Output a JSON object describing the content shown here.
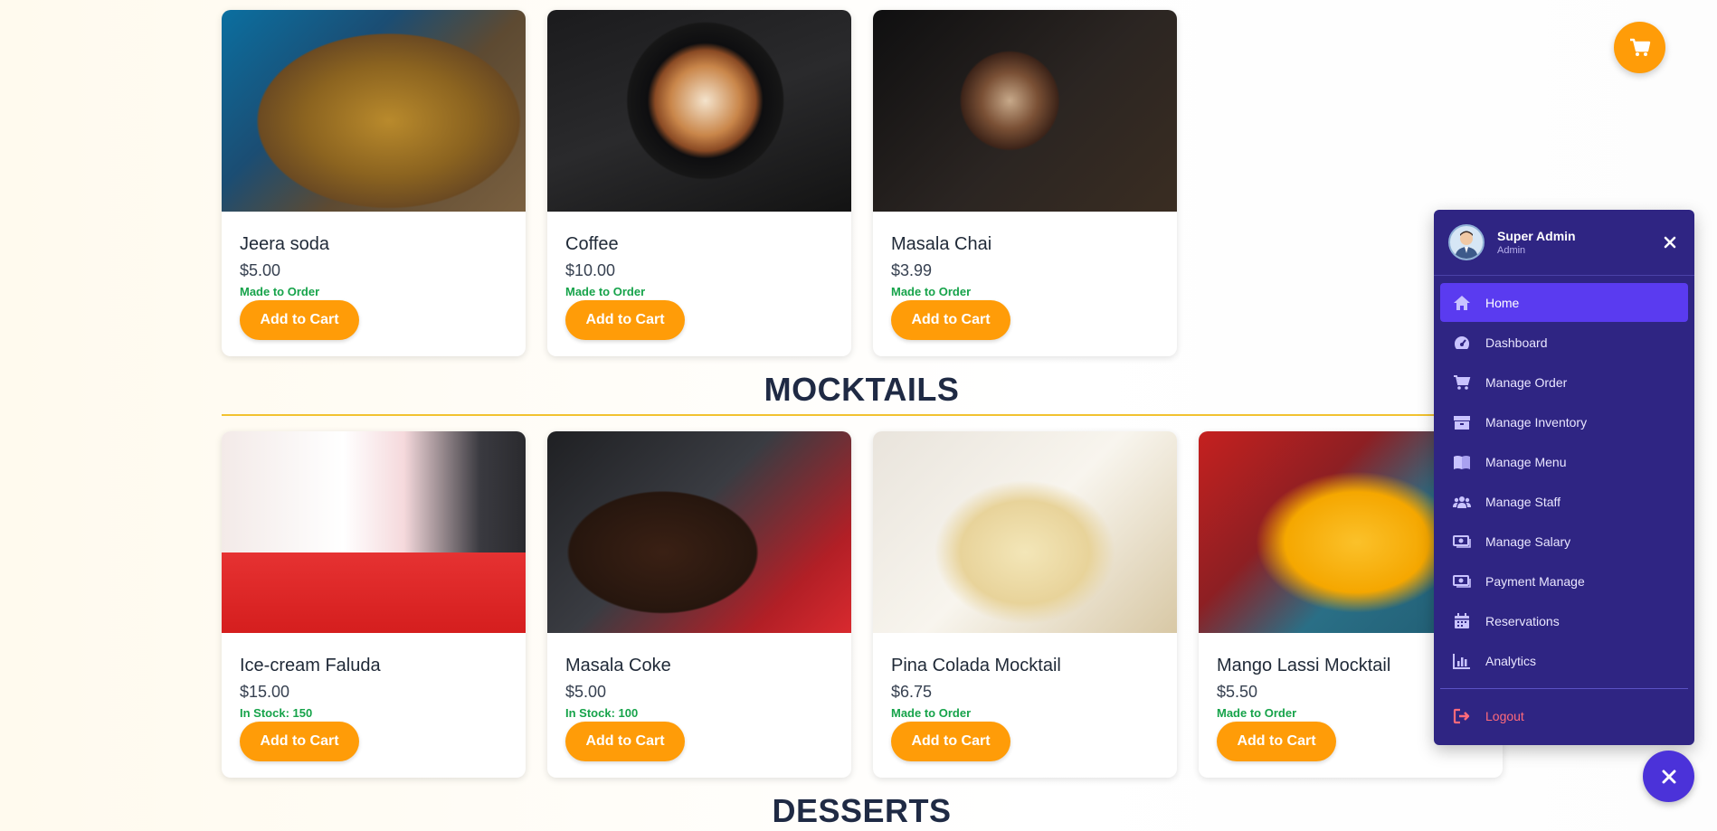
{
  "drinks": [
    {
      "name": "Jeera soda",
      "price": "$5.00",
      "stock": "Made to Order",
      "button": "Add to Cart"
    },
    {
      "name": "Coffee",
      "price": "$10.00",
      "stock": "Made to Order",
      "button": "Add to Cart"
    },
    {
      "name": "Masala Chai",
      "price": "$3.99",
      "stock": "Made to Order",
      "button": "Add to Cart"
    }
  ],
  "mocktails_title": "MOCKTAILS",
  "mocktails": [
    {
      "name": "Ice-cream Faluda",
      "price": "$15.00",
      "stock": "In Stock: 150",
      "button": "Add to Cart"
    },
    {
      "name": "Masala Coke",
      "price": "$5.00",
      "stock": "In Stock: 100",
      "button": "Add to Cart"
    },
    {
      "name": "Pina Colada Mocktail",
      "price": "$6.75",
      "stock": "Made to Order",
      "button": "Add to Cart"
    },
    {
      "name": "Mango Lassi Mocktail",
      "price": "$5.50",
      "stock": "Made to Order",
      "button": "Add to Cart"
    }
  ],
  "desserts_title": "DESSERTS",
  "menu": {
    "user_name": "Super Admin",
    "user_role": "Admin",
    "items": [
      {
        "label": "Home",
        "icon": "home-icon"
      },
      {
        "label": "Dashboard",
        "icon": "gauge-icon"
      },
      {
        "label": "Manage Order",
        "icon": "cart-icon"
      },
      {
        "label": "Manage Inventory",
        "icon": "box-icon"
      },
      {
        "label": "Manage Menu",
        "icon": "book-icon"
      },
      {
        "label": "Manage Staff",
        "icon": "users-icon"
      },
      {
        "label": "Manage Salary",
        "icon": "money-icon"
      },
      {
        "label": "Payment Manage",
        "icon": "money-icon"
      },
      {
        "label": "Reservations",
        "icon": "calendar-icon"
      },
      {
        "label": "Analytics",
        "icon": "chart-icon"
      }
    ],
    "logout": "Logout"
  },
  "colors": {
    "accent": "#ff9c08",
    "menu_bg": "#2f2583",
    "menu_active": "#5a3bf0",
    "stock_green": "#16a34a",
    "section_line": "#f2c230",
    "logout_red": "#ff6a7a"
  }
}
